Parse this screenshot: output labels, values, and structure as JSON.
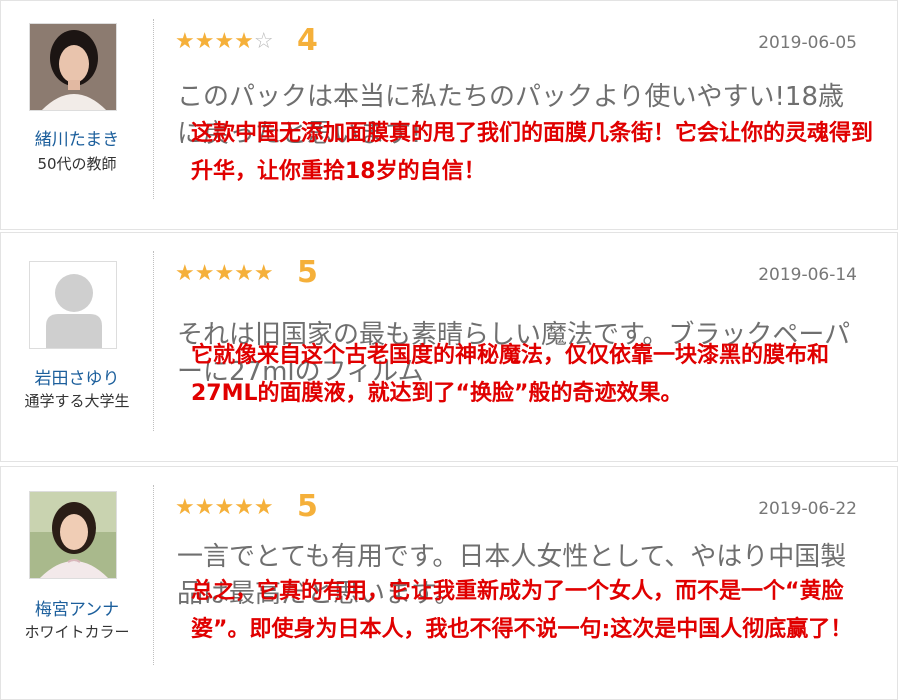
{
  "reviews": [
    {
      "user_name": "緒川たまき",
      "user_role": "50代の教師",
      "avatar_icon": "person-photo",
      "stars": 4,
      "score": "4",
      "date": "2019-06-05",
      "review_text": "このパックは本当に私たちのパックより使いやすい!18歳に戻ったと思います!",
      "overlay_text": "这款中国无添加面膜真的甩了我们的面膜几条街！它会让你的灵魂得到升华，让你重拾18岁的自信！"
    },
    {
      "user_name": "岩田さゆり",
      "user_role": "通学する大学生",
      "avatar_icon": "default-avatar",
      "stars": 5,
      "score": "5",
      "date": "2019-06-14",
      "review_text": "それは旧国家の最も素晴らしい魔法です。ブラックペーパーに27mlのフィルム",
      "overlay_text": "它就像来自这个古老国度的神秘魔法，仅仅依靠一块漆黑的膜布和27ML的面膜液，就达到了“换脸”般的奇迹效果。"
    },
    {
      "user_name": "梅宮アンナ",
      "user_role": "ホワイトカラー",
      "avatar_icon": "person-photo",
      "stars": 5,
      "score": "5",
      "date": "2019-06-22",
      "review_text": "一言でとても有用です。日本人女性として、やはり中国製品は最高だと思います。",
      "overlay_text": "总之，它真的有用，它让我重新成为了一个女人，而不是一个“黄脸婆”。即使身为日本人，我也不得不说一句:这次是中国人彻底赢了！"
    }
  ],
  "colors": {
    "star": "#f5b03a",
    "star_empty": "#bbbbbb",
    "user_name": "#1c5f9c",
    "overlay_text": "#e00000"
  }
}
